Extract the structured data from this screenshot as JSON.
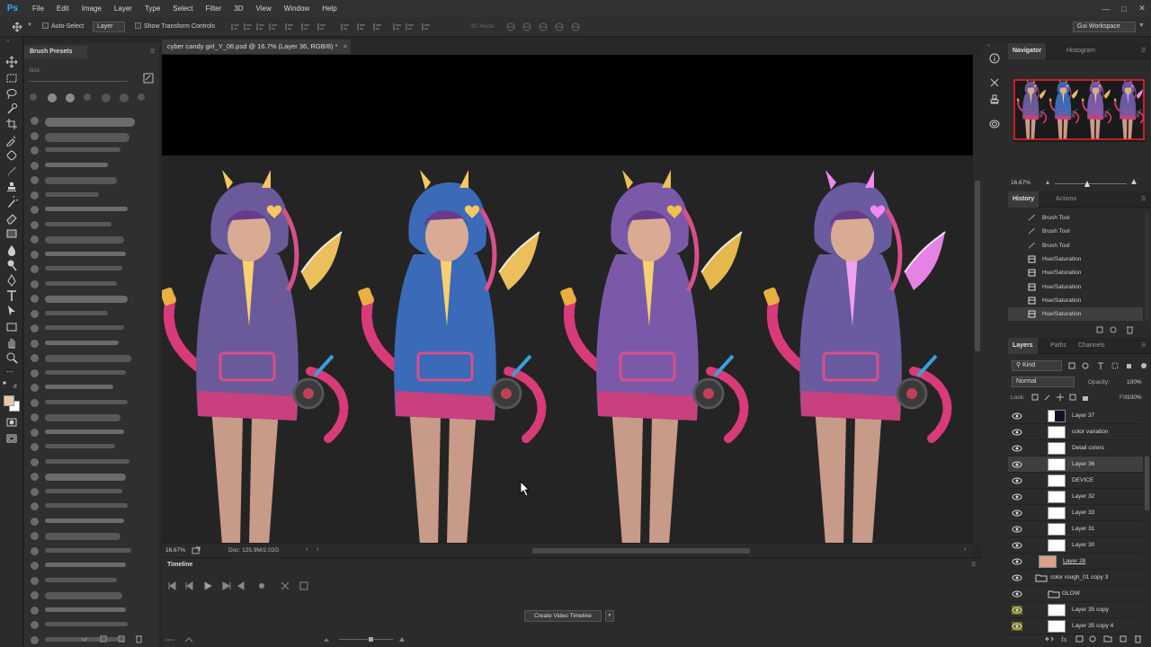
{
  "app": {
    "logo": "Ps",
    "accent": "#31a8ff"
  },
  "menu": [
    "File",
    "Edit",
    "Image",
    "Layer",
    "Type",
    "Select",
    "Filter",
    "3D",
    "View",
    "Window",
    "Help"
  ],
  "window_controls": [
    "minimize-icon",
    "maximize-icon",
    "close-icon"
  ],
  "options": {
    "auto_select": "Auto-Select",
    "auto_select_target": "Layer",
    "show_transform": "Show Transform Controls",
    "mode_3d": "3D Mode:",
    "workspace": "Gui Workspace"
  },
  "brush_presets": {
    "title": "Brush Presets",
    "size_label": "Size:"
  },
  "document": {
    "tab_title": "cyber candy girl_Y_06.psd @ 16.7% (Layer 36, RGB/8) *",
    "zoom": "16.67%",
    "doc_info": "Doc: 125.9M/2.02G"
  },
  "timeline": {
    "title": "Timeline",
    "create_button": "Create Video Timeline"
  },
  "navigator": {
    "tabs": [
      "Navigator",
      "Histogram"
    ],
    "zoom": "16.67%",
    "zoom_slider_fraction": 0.45
  },
  "history": {
    "tabs": [
      "History",
      "Actions"
    ],
    "items": [
      {
        "label": "Brush Tool",
        "icon": "brush-icon"
      },
      {
        "label": "Brush Tool",
        "icon": "brush-icon"
      },
      {
        "label": "Brush Tool",
        "icon": "brush-icon"
      },
      {
        "label": "Hue/Saturation",
        "icon": "adjustment-icon"
      },
      {
        "label": "Hue/Saturation",
        "icon": "adjustment-icon"
      },
      {
        "label": "Hue/Saturation",
        "icon": "adjustment-icon"
      },
      {
        "label": "Hue/Saturation",
        "icon": "adjustment-icon"
      },
      {
        "label": "Hue/Saturation",
        "icon": "adjustment-icon"
      }
    ]
  },
  "layers": {
    "tabs": [
      "Layers",
      "Paths",
      "Channels"
    ],
    "filter": "Kind",
    "blend_mode": "Normal",
    "opacity_label": "Opacity:",
    "opacity": "100%",
    "lock_label": "Lock:",
    "fill_label": "Fill:",
    "fill": "100%",
    "items": [
      {
        "name": "Layer 37",
        "selected": false
      },
      {
        "name": "color variation",
        "selected": false
      },
      {
        "name": "Detail colors",
        "selected": false
      },
      {
        "name": "Layer 36",
        "selected": true
      },
      {
        "name": "DEVICE",
        "selected": false
      },
      {
        "name": "Layer 32",
        "selected": false
      },
      {
        "name": "Layer 33",
        "selected": false
      },
      {
        "name": "Layer 31",
        "selected": false
      },
      {
        "name": "Layer 30",
        "selected": false
      },
      {
        "name": "Layer 28",
        "selected": false
      },
      {
        "name": "color rough_01 copy 3",
        "selected": false
      },
      {
        "name": "GLOW",
        "selected": false
      },
      {
        "name": "Layer 35 copy",
        "selected": false
      },
      {
        "name": "Layer 35 copy 4",
        "selected": false
      }
    ]
  },
  "colors": {
    "foreground": "#e8c8a8",
    "background": "#ffffff",
    "selection": "#3f3f3f"
  }
}
